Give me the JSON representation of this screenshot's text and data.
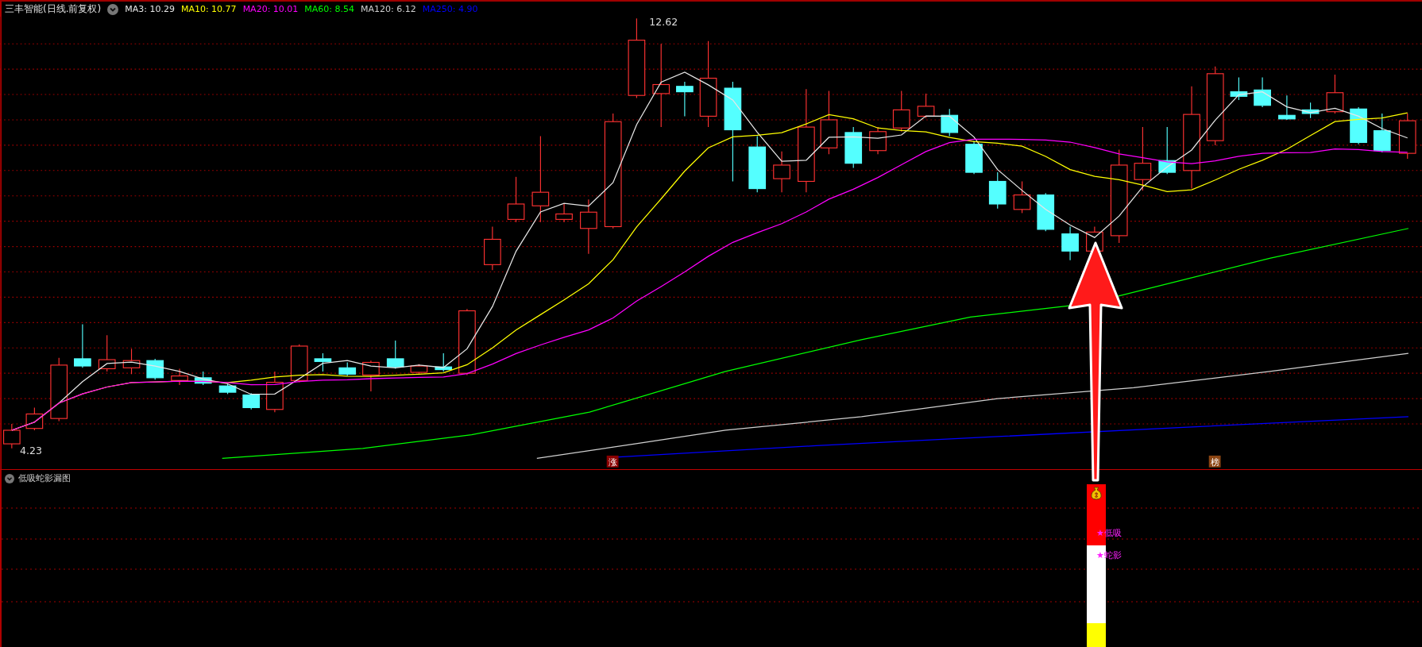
{
  "chart": {
    "title": "三丰智能(日线.前复权)",
    "moving_averages": [
      {
        "label": "MA3: 10.29",
        "color": "#e6e6e6"
      },
      {
        "label": "MA10: 10.77",
        "color": "#ffff00"
      },
      {
        "label": "MA20: 10.01",
        "color": "#ff00ff"
      },
      {
        "label": "MA60: 8.54",
        "color": "#00ff00"
      },
      {
        "label": "MA120: 6.12",
        "color": "#d0d0d0"
      },
      {
        "label": "MA250: 4.90",
        "color": "#0000ff"
      }
    ],
    "high_label": "12.62",
    "low_label": "4.23",
    "markers": [
      {
        "text": "涨",
        "color": "#8b0000"
      },
      {
        "text": "榜",
        "color": "#8b4513"
      }
    ]
  },
  "indicator": {
    "title": "低吸蛇影漏图",
    "bar_segments": [
      {
        "color": "#ff0000"
      },
      {
        "color": "#ffffff"
      },
      {
        "color": "#ffff00"
      }
    ],
    "signals": [
      {
        "text": "★低吸"
      },
      {
        "text": "★蛇影"
      }
    ]
  }
}
